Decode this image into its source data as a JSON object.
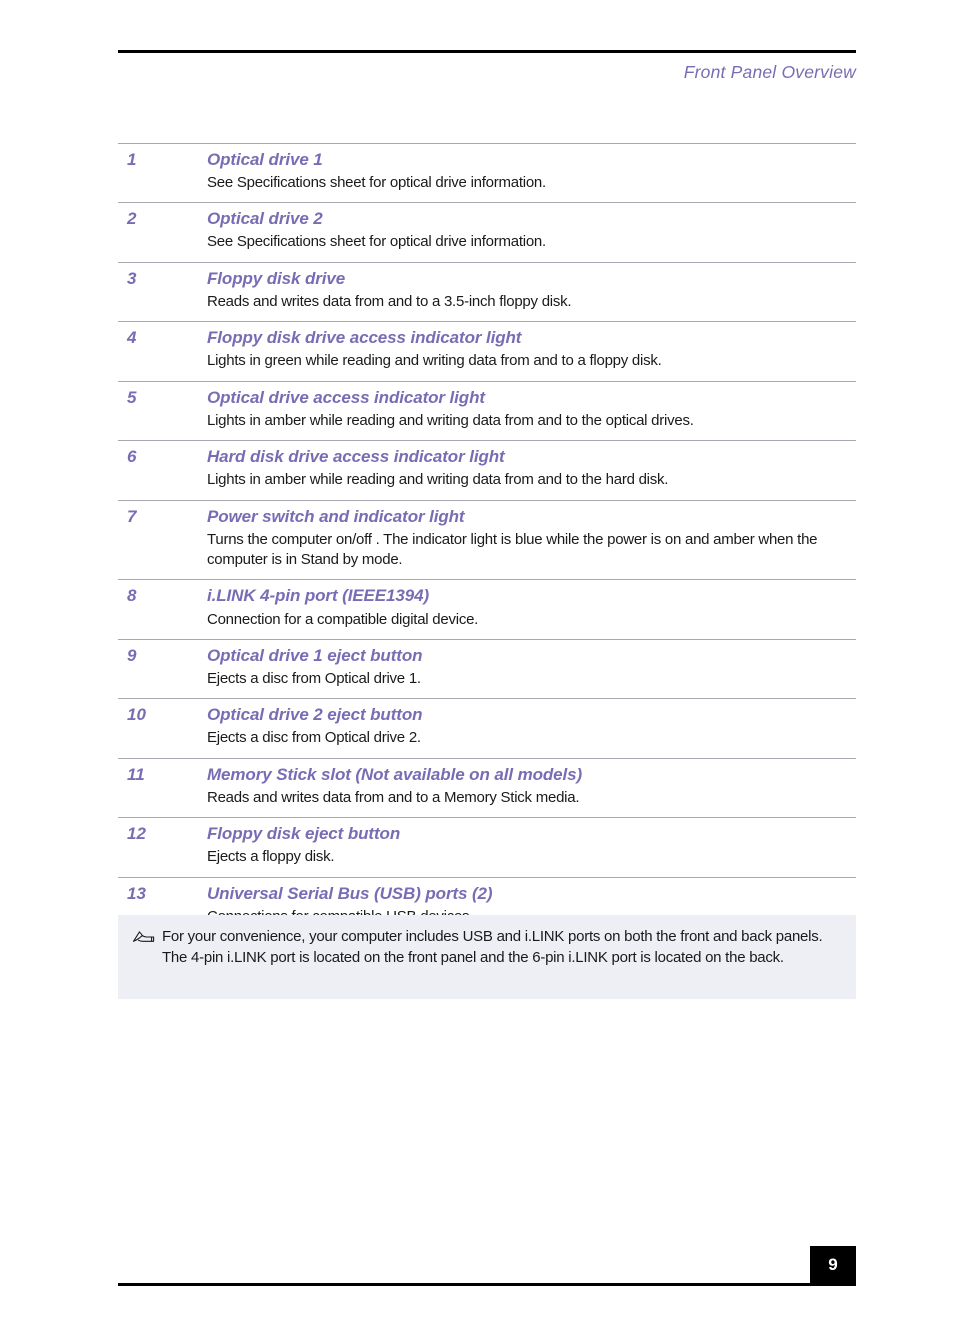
{
  "header": {
    "title": "Front Panel Overview"
  },
  "table": {
    "rows": [
      {
        "number": "1",
        "title": "Optical drive 1",
        "description": "See Specifications sheet for optical drive information."
      },
      {
        "number": "2",
        "title": "Optical drive 2",
        "description": "See Specifications sheet for optical drive information."
      },
      {
        "number": "3",
        "title": "Floppy disk drive",
        "description": "Reads and writes data from and to a 3.5-inch floppy disk."
      },
      {
        "number": "4",
        "title": "Floppy disk drive access indicator light",
        "description": "Lights in green while reading and writing data from and to a floppy disk."
      },
      {
        "number": "5",
        "title": "Optical drive access indicator light",
        "description": "Lights in amber while reading and writing data from and to the optical drives."
      },
      {
        "number": "6",
        "title": "Hard disk drive access indicator light",
        "description": "Lights in amber while reading and writing data from and to the hard disk."
      },
      {
        "number": "7",
        "title": "Power switch and indicator light",
        "description": "Turns the computer on/off . The indicator light is blue while the power is on and amber when the computer is in Stand by mode."
      },
      {
        "number": "8",
        "title": "i.LINK 4-pin port (IEEE1394)",
        "description": "Connection for a compatible digital device."
      },
      {
        "number": "9",
        "title": "Optical drive 1 eject button",
        "description": "Ejects a disc from Optical drive 1."
      },
      {
        "number": "10",
        "title": "Optical drive 2 eject button",
        "description": "Ejects a disc from Optical drive 2."
      },
      {
        "number": "11",
        "title": "Memory Stick slot (Not available on all models)",
        "description": "Reads and writes data from and to a Memory Stick media."
      },
      {
        "number": "12",
        "title": "Floppy disk eject button",
        "description": "Ejects a floppy disk."
      },
      {
        "number": "13",
        "title": "Universal Serial Bus (USB) ports (2)",
        "description": "Connections for compatible USB devices."
      }
    ]
  },
  "note": {
    "icon": "note-pencil-icon",
    "text": "For your convenience, your computer includes USB and i.LINK ports on both the front and back panels. The 4-pin i.LINK port is located on the front panel and the 6-pin i.LINK port is located on the back."
  },
  "footer": {
    "page_number": "9"
  },
  "colors": {
    "accent_purple": "#7a6cb4",
    "note_background": "#eeeef5",
    "rule_black": "#000000",
    "separator_gray": "#a9a9b2"
  }
}
